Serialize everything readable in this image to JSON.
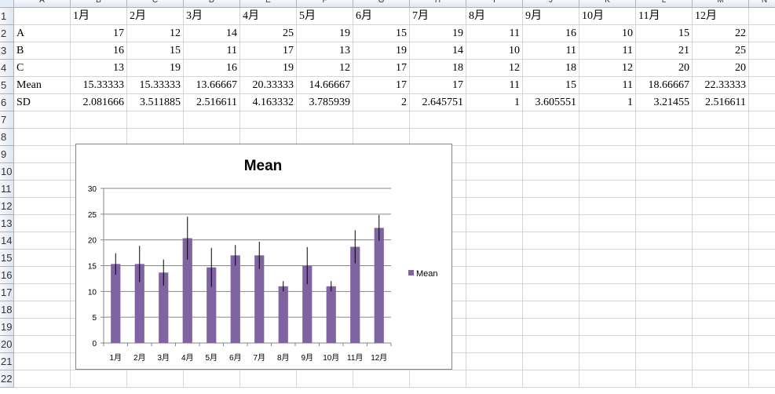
{
  "columns": [
    "A",
    "B",
    "C",
    "D",
    "E",
    "F",
    "G",
    "H",
    "I",
    "J",
    "K",
    "L",
    "M",
    "N"
  ],
  "rows": [
    "1",
    "2",
    "3",
    "4",
    "5",
    "6",
    "7",
    "8",
    "9",
    "10",
    "11",
    "12",
    "13",
    "14",
    "15",
    "16",
    "17",
    "18",
    "19",
    "20",
    "21",
    "22"
  ],
  "cells": {
    "header": [
      "",
      "1月",
      "2月",
      "3月",
      "4月",
      "5月",
      "6月",
      "7月",
      "8月",
      "9月",
      "10月",
      "11月",
      "12月"
    ],
    "A": [
      "A",
      "17",
      "12",
      "14",
      "25",
      "19",
      "15",
      "19",
      "11",
      "16",
      "10",
      "15",
      "22"
    ],
    "B": [
      "B",
      "16",
      "15",
      "11",
      "17",
      "13",
      "19",
      "14",
      "10",
      "11",
      "11",
      "21",
      "25"
    ],
    "C": [
      "C",
      "13",
      "19",
      "16",
      "19",
      "12",
      "17",
      "18",
      "12",
      "18",
      "12",
      "20",
      "20"
    ],
    "Mean": [
      "Mean",
      "15.33333",
      "15.33333",
      "13.66667",
      "20.33333",
      "14.66667",
      "17",
      "17",
      "11",
      "15",
      "11",
      "18.66667",
      "22.33333"
    ],
    "SD": [
      "SD",
      "2.081666",
      "3.511885",
      "2.516611",
      "4.163332",
      "3.785939",
      "2",
      "2.645751",
      "1",
      "3.605551",
      "1",
      "3.21455",
      "2.516611"
    ]
  },
  "chart_data": {
    "type": "bar",
    "title": "Mean",
    "categories": [
      "1月",
      "2月",
      "3月",
      "4月",
      "5月",
      "6月",
      "7月",
      "8月",
      "9月",
      "10月",
      "11月",
      "12月"
    ],
    "series": [
      {
        "name": "Mean",
        "values": [
          15.33333,
          15.33333,
          13.66667,
          20.33333,
          14.66667,
          17,
          17,
          11,
          15,
          11,
          18.66667,
          22.33333
        ],
        "error": [
          2.081666,
          3.511885,
          2.516611,
          4.163332,
          3.785939,
          2,
          2.645751,
          1,
          3.605551,
          1,
          3.21455,
          2.516611
        ],
        "color": "#8064a2"
      }
    ],
    "yticks": [
      "0",
      "5",
      "10",
      "15",
      "20",
      "25",
      "30"
    ],
    "ylim": [
      0,
      30
    ],
    "grid": true,
    "legend": "right"
  }
}
